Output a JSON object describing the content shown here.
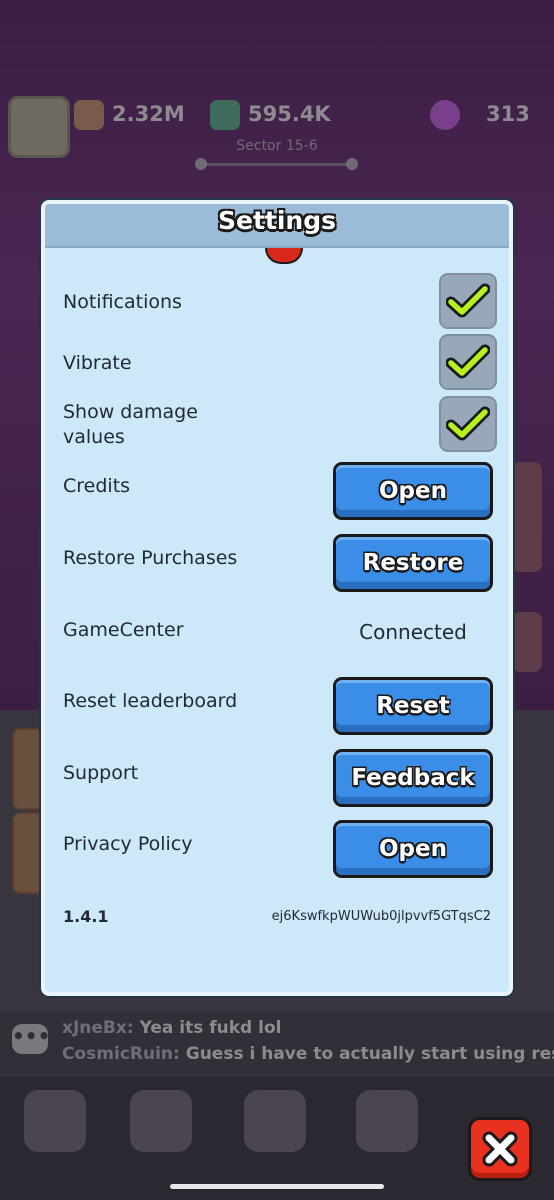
{
  "background": {
    "hud": {
      "power_value": "2.32M",
      "currency_value": "595.4K",
      "gems_value": "313",
      "sector_label": "Sector 15-6"
    },
    "chat": {
      "line1_user": "xJneBx:",
      "line1_text": "Yea its fukd lol",
      "line2_user": "CosmicRuin:",
      "line2_text": "Guess i have to actually start using reso"
    }
  },
  "settings": {
    "title": "Settings",
    "rows": {
      "notifications": {
        "label": "Notifications",
        "checked": true
      },
      "vibrate": {
        "label": "Vibrate",
        "checked": true
      },
      "show_damage": {
        "label_line1": "Show damage",
        "label_line2": "values",
        "checked": true
      },
      "credits": {
        "label": "Credits",
        "button": "Open"
      },
      "restore": {
        "label": "Restore Purchases",
        "button": "Restore"
      },
      "gamecenter": {
        "label": "GameCenter",
        "status": "Connected"
      },
      "reset": {
        "label": "Reset leaderboard",
        "button": "Reset"
      },
      "support": {
        "label": "Support",
        "button": "Feedback"
      },
      "privacy": {
        "label": "Privacy Policy",
        "button": "Open"
      }
    },
    "version": "1.4.1",
    "player_id": "ej6KswfkpWUWub0jlpvvf5GTqsC2"
  },
  "colors": {
    "dialog_bg": "#cde8f8",
    "button_blue": "#3b8ee8",
    "check_green": "#b6f21e",
    "close_red": "#e8321f"
  },
  "icons": {
    "check": "checkmark-icon",
    "close": "close-x-icon"
  }
}
